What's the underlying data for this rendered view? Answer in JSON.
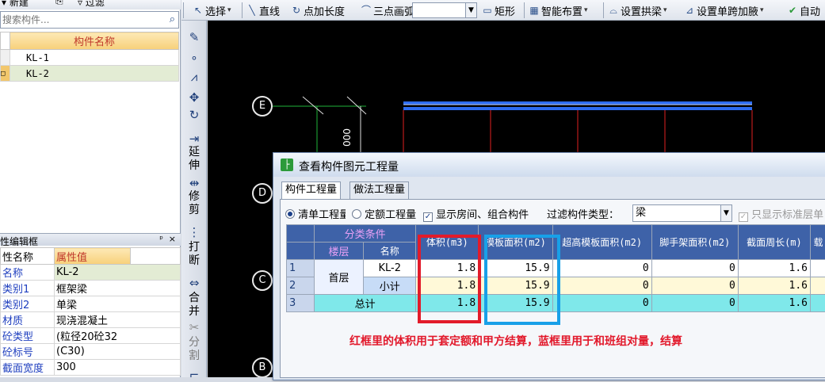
{
  "toolbar": {
    "left_new": "新建",
    "left_filter": "过滤",
    "select": "选择",
    "line": "直线",
    "point_length": "点加长度",
    "three_point_arc": "三点画弧",
    "rectangle": "矩形",
    "smart_layout": "智能布置",
    "set_arch_beam": "设置拱梁",
    "set_span_haunch": "设置单跨加腋",
    "auto": "自动"
  },
  "component_list": {
    "search_placeholder": "搜索构件...",
    "header": "构件名称",
    "items": [
      {
        "name": "KL-1"
      },
      {
        "name": "KL-2"
      }
    ]
  },
  "property_editor": {
    "title": "性编辑框",
    "pin": "ᵖ",
    "close": "×",
    "col_name": "性名称",
    "col_value": "属性值",
    "rows": [
      {
        "name": "名称",
        "value": "KL-2"
      },
      {
        "name": "类别1",
        "value": "框架梁"
      },
      {
        "name": "类别2",
        "value": "单梁"
      },
      {
        "name": "材质",
        "value": "现浇混凝土"
      },
      {
        "name": "砼类型",
        "value": "(粒径20砼32"
      },
      {
        "name": "砼标号",
        "value": "(C30)"
      },
      {
        "name": "截面宽度",
        "value": "300"
      }
    ]
  },
  "vstrip": {
    "extend": "延伸",
    "trim": "修剪",
    "break": "打断",
    "merge": "合并",
    "split": "分割"
  },
  "canvas": {
    "axes": [
      "E",
      "D",
      "C",
      "B"
    ],
    "dim_text": "000"
  },
  "dialog": {
    "title": "查看构件图元工程量",
    "tabs": [
      "构件工程量",
      "做法工程量"
    ],
    "radio_list": "清单工程量",
    "radio_quota": "定额工程量",
    "check_rooms": "显示房间、组合构件",
    "filter_label": "过滤构件类型：",
    "filter_value": "梁",
    "check_std_floor": "只显示标准层单",
    "table": {
      "group_header": "分类条件",
      "col_floor": "楼层",
      "col_name": "名称",
      "col_volume": "体积(m3)",
      "col_formwork": "模板面积(m2)",
      "col_high_formwork": "超高模板面积(m2)",
      "col_scaffold": "脚手架面积(m2)",
      "col_perimeter": "截面周长(m)",
      "col_extra": "载",
      "rows": [
        {
          "idx": "1",
          "floor": "首层",
          "name": "KL-2",
          "volume": "1.8",
          "formwork": "15.9",
          "high": "0",
          "scaffold": "0",
          "perimeter": "1.6"
        },
        {
          "idx": "2",
          "floor": "",
          "name": "小计",
          "volume": "1.8",
          "formwork": "15.9",
          "high": "0",
          "scaffold": "0",
          "perimeter": "1.6"
        },
        {
          "idx": "3",
          "floor": "总计",
          "name": "",
          "volume": "1.8",
          "formwork": "15.9",
          "high": "0",
          "scaffold": "0",
          "perimeter": "1.6"
        }
      ]
    }
  },
  "annotation": {
    "note": "红框里的体积用于套定额和甲方结算，蓝框里用于和班组对量，结算",
    "red_color": "#e21b2a",
    "blue_color": "#18a0e8"
  }
}
